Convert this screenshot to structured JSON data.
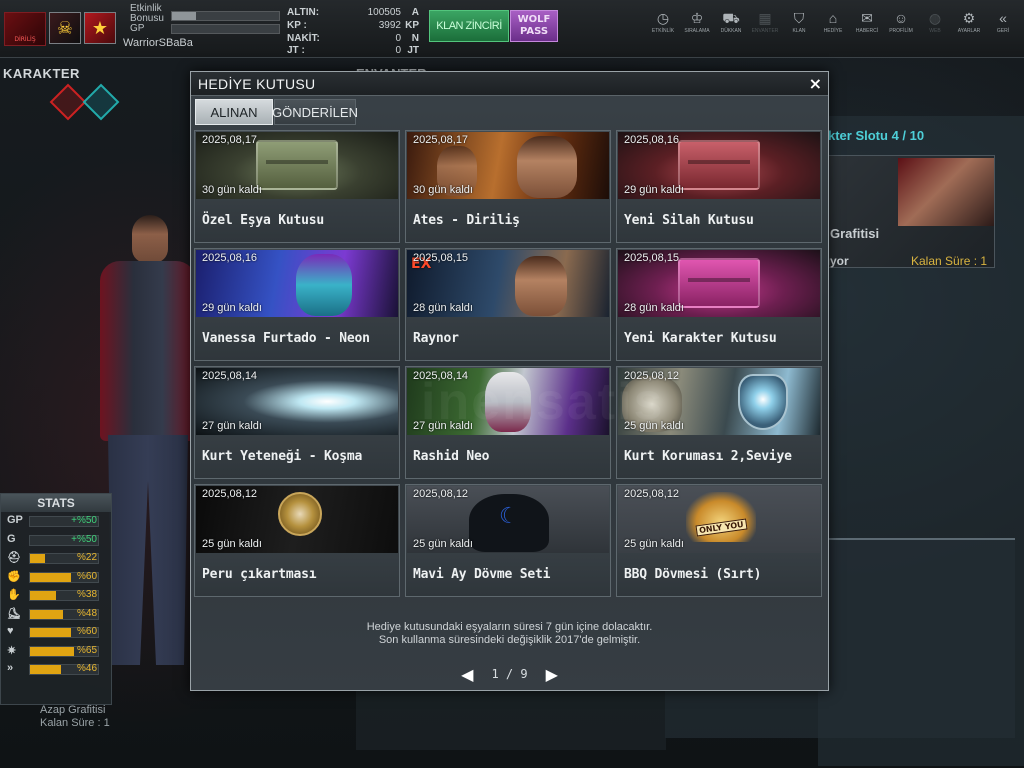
{
  "topbar": {
    "logo_text": "DİRİLİŞ",
    "event_bonus_label": "Etkinlik Bonusu",
    "event_bonus_fill": 0.22,
    "gp_label": "GP",
    "gp_fill": 0.0,
    "username": "WarriorSBaBa",
    "currency": [
      {
        "key": "ALTIN:",
        "value": "100505",
        "unit": "A"
      },
      {
        "key": "KP :",
        "value": "3992",
        "unit": "KP"
      },
      {
        "key": "NAKİT:",
        "value": "0",
        "unit": "N"
      },
      {
        "key": "JT :",
        "value": "0",
        "unit": "JT"
      }
    ],
    "klan_button": "KLAN ZİNCİRİ",
    "wolf_button": "WOLF PASS",
    "nav": [
      {
        "label": "ETKİNLİK",
        "icon": "clock-icon",
        "glyph": "◷",
        "enabled": true
      },
      {
        "label": "SIRALAMA",
        "icon": "rank-icon",
        "glyph": "♔",
        "enabled": true
      },
      {
        "label": "DÜKKAN",
        "icon": "cart-icon",
        "glyph": "⛟",
        "enabled": true
      },
      {
        "label": "ENVANTER",
        "icon": "inventory-icon",
        "glyph": "▦",
        "enabled": false
      },
      {
        "label": "KLAN",
        "icon": "shield-icon",
        "glyph": "⛉",
        "enabled": true
      },
      {
        "label": "HEDİYE",
        "icon": "gift-icon",
        "glyph": "⌂",
        "enabled": true
      },
      {
        "label": "HABERCİ",
        "icon": "megaphone-icon",
        "glyph": "✉",
        "enabled": true
      },
      {
        "label": "PROFİLİM",
        "icon": "profile-icon",
        "glyph": "☺",
        "enabled": true
      },
      {
        "label": "WEB",
        "icon": "globe-icon",
        "glyph": "◍",
        "enabled": false
      },
      {
        "label": "AYARLAR",
        "icon": "gear-icon",
        "glyph": "⚙",
        "enabled": true
      },
      {
        "label": "GERİ",
        "icon": "back-icon",
        "glyph": "«",
        "enabled": true
      }
    ]
  },
  "character": {
    "title": "KARAKTER",
    "stats_title": "STATS",
    "stats": [
      {
        "icon": "gp-icon",
        "label": "GP",
        "value": "+%50",
        "color": "green",
        "fill": 0
      },
      {
        "icon": "g-icon",
        "label": "G",
        "value": "+%50",
        "color": "green",
        "fill": 0
      },
      {
        "icon": "helmet-icon",
        "label": "⛑",
        "value": "%22",
        "color": "yellow",
        "fill": 0.22
      },
      {
        "icon": "grenade-icon",
        "label": "✊",
        "value": "%60",
        "color": "yellow",
        "fill": 0.6
      },
      {
        "icon": "hand-icon",
        "label": "✋",
        "value": "%38",
        "color": "yellow",
        "fill": 0.38
      },
      {
        "icon": "boot-icon",
        "label": "⛸",
        "value": "%48",
        "color": "yellow",
        "fill": 0.48
      },
      {
        "icon": "heart-icon",
        "label": "♥",
        "value": "%60",
        "color": "yellow",
        "fill": 0.6
      },
      {
        "icon": "burst-icon",
        "label": "✷",
        "value": "%65",
        "color": "yellow",
        "fill": 0.65
      },
      {
        "icon": "speed-icon",
        "label": "»",
        "value": "%46",
        "color": "yellow",
        "fill": 0.46
      }
    ],
    "bottom_item_name": "Azap Grafitisi",
    "bottom_item_time": "Kalan Süre : 1"
  },
  "envanter_title": "ENVANTER",
  "slot": {
    "title": "kter Slotu 4 / 10",
    "item_name": "Grafitisi",
    "status": "ılıyor",
    "time": "Kalan Süre : 1"
  },
  "modal": {
    "title": "HEDİYE KUTUSU",
    "close": "×",
    "tabs": [
      {
        "label": "ALINAN",
        "active": true
      },
      {
        "label": "GÖNDERİLEN",
        "active": false
      }
    ],
    "gifts": [
      {
        "date": "2025,08,17",
        "days": "30 gün kaldı",
        "name": "Özel Eşya Kutusu",
        "art": "crate-green"
      },
      {
        "date": "2025,08,17",
        "days": "30 gün kaldı",
        "name": "Ates - Diriliş",
        "art": "ates"
      },
      {
        "date": "2025,08,16",
        "days": "29 gün kaldı",
        "name": "Yeni Silah Kutusu",
        "art": "crate-red"
      },
      {
        "date": "2025,08,16",
        "days": "29 gün kaldı",
        "name": "Vanessa Furtado - Neon",
        "art": "neon"
      },
      {
        "date": "2025,08,15",
        "days": "28 gün kaldı",
        "name": "Raynor",
        "art": "raynor"
      },
      {
        "date": "2025,08,15",
        "days": "28 gün kaldı",
        "name": "Yeni Karakter Kutusu",
        "art": "crate-pink"
      },
      {
        "date": "2025,08,14",
        "days": "27 gün kaldı",
        "name": "Kurt Yeteneği - Koşma",
        "art": "kurt"
      },
      {
        "date": "2025,08,14",
        "days": "27 gün kaldı",
        "name": "Rashid Neo",
        "art": "rashid"
      },
      {
        "date": "2025,08,12",
        "days": "25 gün kaldı",
        "name": "Kurt Koruması 2,Seviye",
        "art": "koruma"
      },
      {
        "date": "2025,08,12",
        "days": "25 gün kaldı",
        "name": "Peru çıkartması",
        "art": "peru"
      },
      {
        "date": "2025,08,12",
        "days": "25 gün kaldı",
        "name": "Mavi Ay Dövme Seti",
        "art": "mavi"
      },
      {
        "date": "2025,08,12",
        "days": "25 gün kaldı",
        "name": "BBQ Dövmesi (Sırt)",
        "art": "bbq"
      }
    ],
    "footer_line1": "Hediye kutusundaki eşyaların süresi 7 gün içine dolacaktır.",
    "footer_line2": "Son kullanma süresindeki değişiklik 2017'de gelmiştir.",
    "pager": {
      "prev": "◀",
      "next": "▶",
      "page": "1 / 9"
    }
  },
  "watermark": "inensatis"
}
